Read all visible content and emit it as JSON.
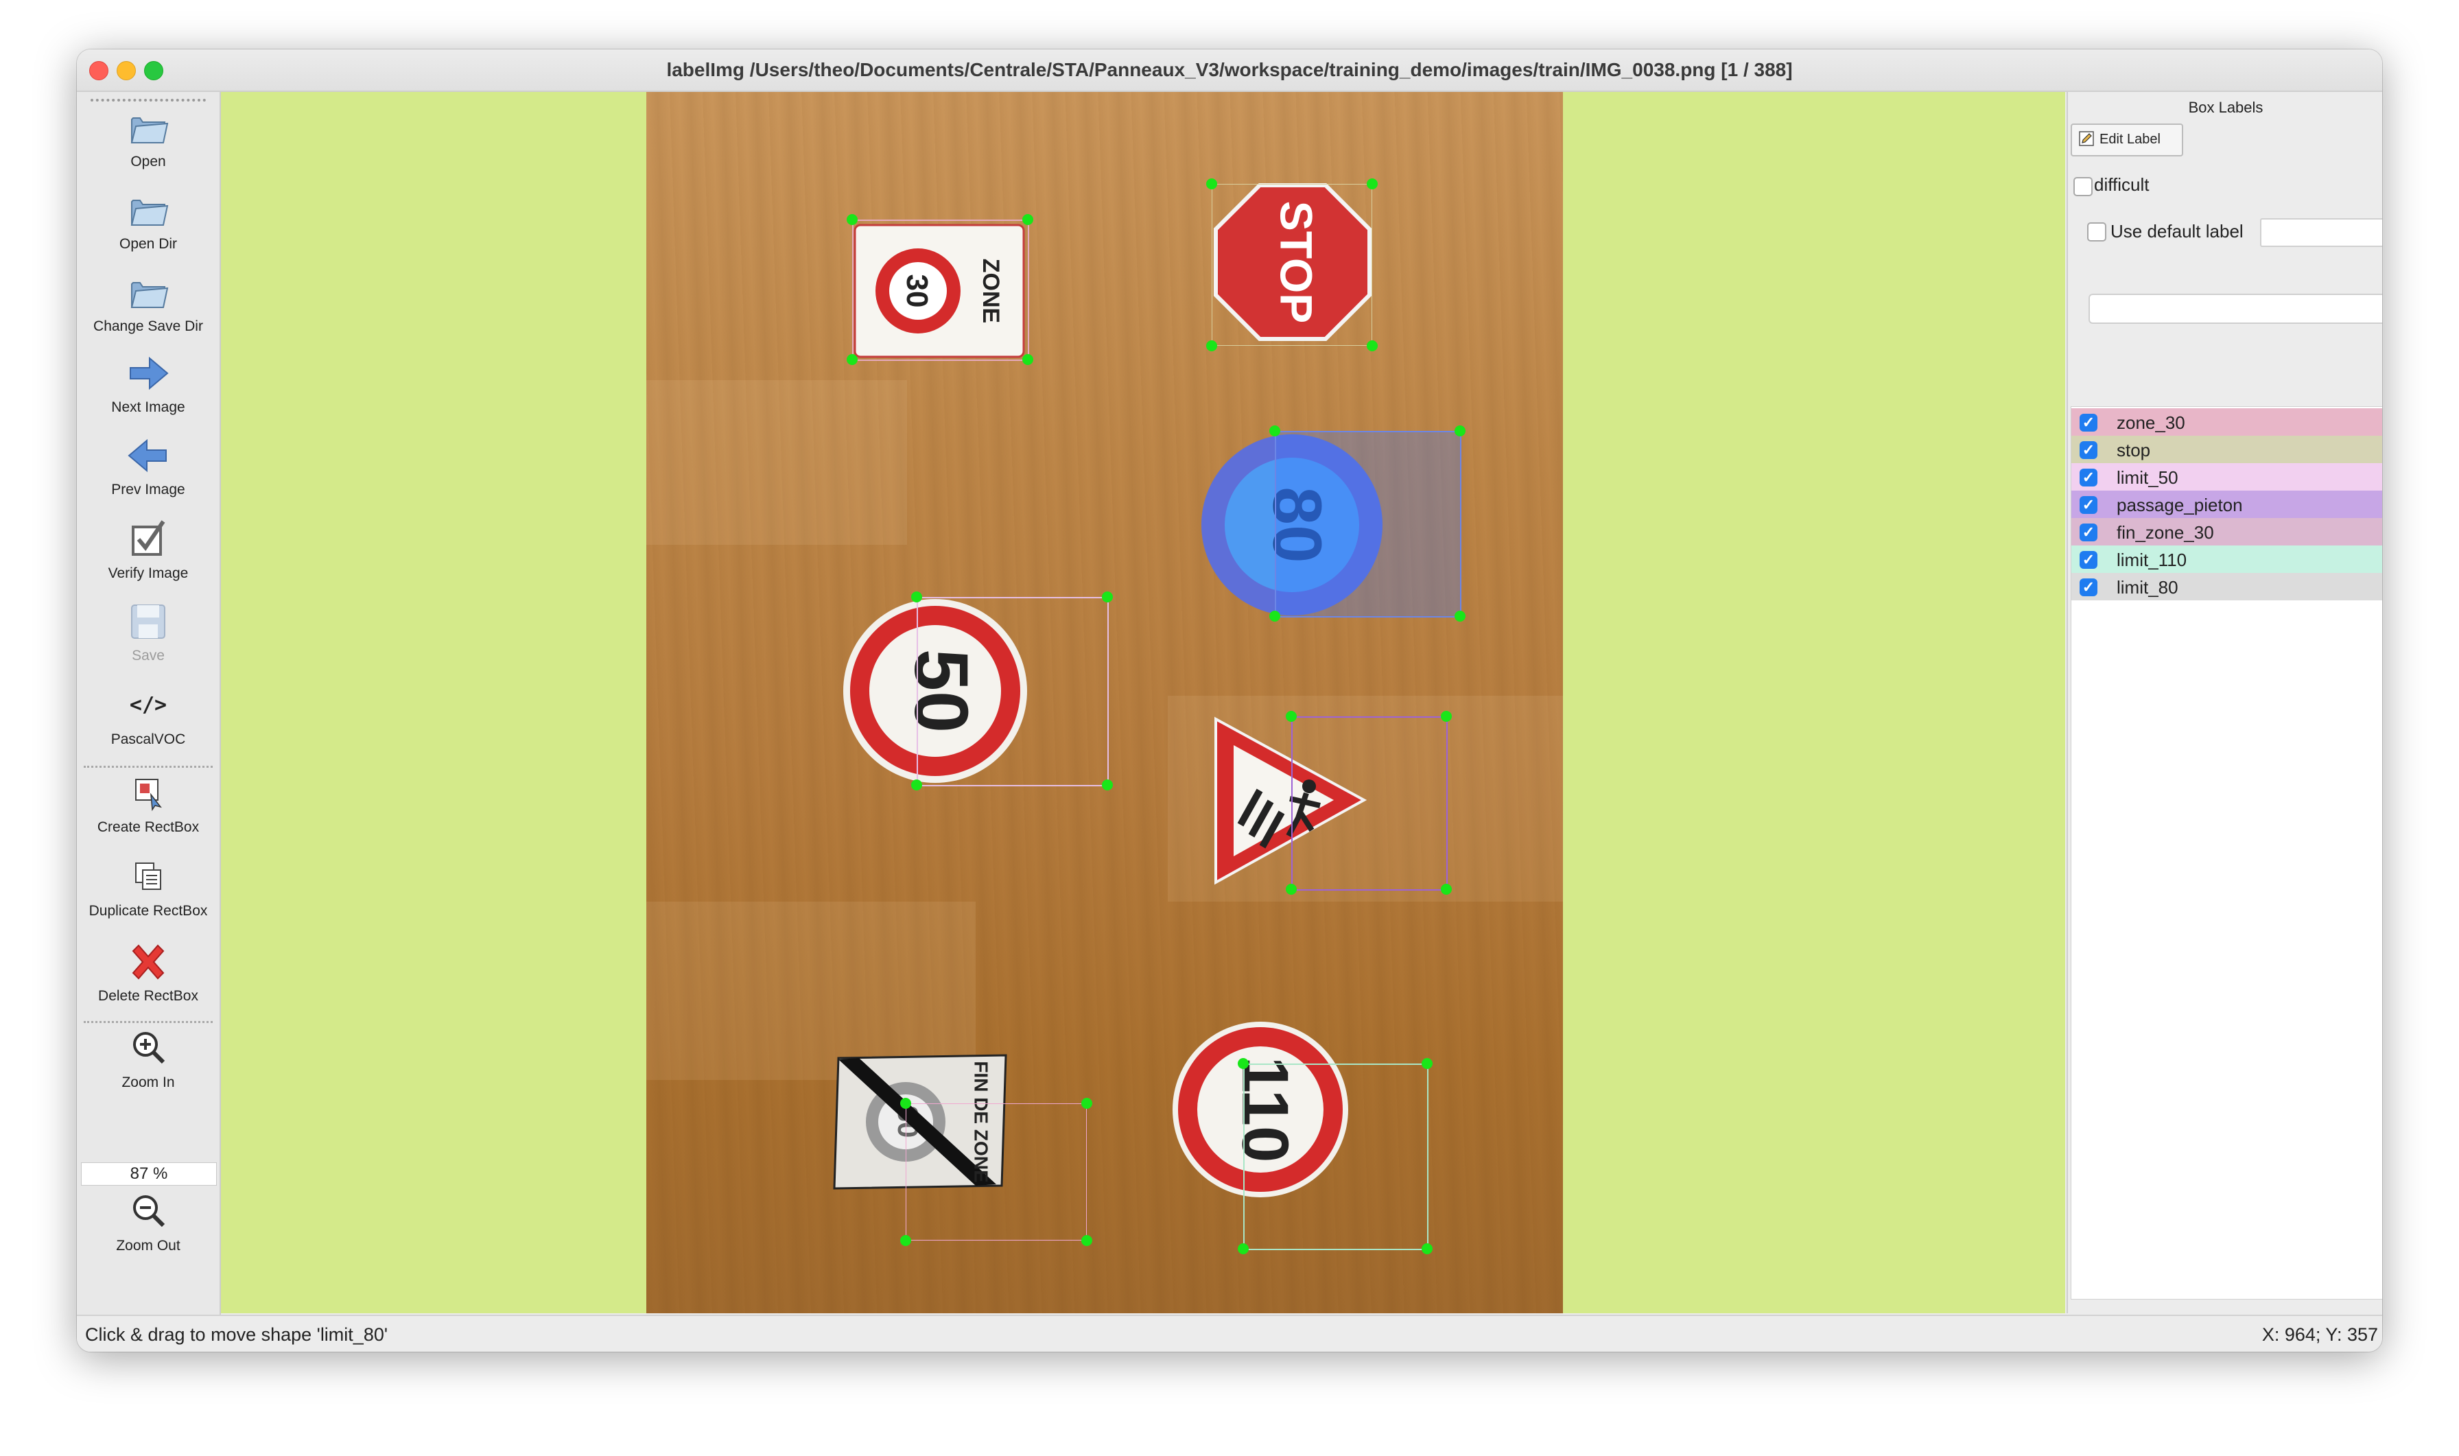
{
  "window": {
    "title": "labelImg /Users/theo/Documents/Centrale/STA/Panneaux_V3/workspace/training_demo/images/train/IMG_0038.png [1 / 388]"
  },
  "toolbar": {
    "open": "Open",
    "open_dir": "Open Dir",
    "change_save_dir": "Change Save Dir",
    "next_image": "Next Image",
    "prev_image": "Prev Image",
    "verify_image": "Verify Image",
    "save": "Save",
    "format": "PascalVOC",
    "format_icon_text": "</>",
    "create_rectbox": "Create RectBox",
    "duplicate_rectbox": "Duplicate RectBox",
    "delete_rectbox": "Delete RectBox",
    "zoom_in": "Zoom In",
    "zoom_level": "87 %",
    "zoom_out": "Zoom Out"
  },
  "signs": {
    "stop_text": "STOP",
    "zone_text": "ZONE",
    "zone_number": "30",
    "limit_80": "80",
    "limit_50": "50",
    "limit_110": "110",
    "fin_number": "30",
    "fin_text": "FIN DE ZONE"
  },
  "dock": {
    "title": "Box Labels",
    "edit_label": "Edit Label",
    "difficult": "difficult",
    "use_default_label": "Use default label",
    "default_label_value": "",
    "combo_value": ""
  },
  "labels": [
    {
      "name": "zone_30",
      "color": "#e8b6c8",
      "checked": true
    },
    {
      "name": "stop",
      "color": "#d6d4b4",
      "checked": true
    },
    {
      "name": "limit_50",
      "color": "#f2d0f0",
      "checked": true
    },
    {
      "name": "passage_pieton",
      "color": "#c7a6e6",
      "checked": true
    },
    {
      "name": "fin_zone_30",
      "color": "#dcb8d0",
      "checked": true
    },
    {
      "name": "limit_110",
      "color": "#c6f2e2",
      "checked": true
    },
    {
      "name": "limit_80",
      "color": "#dcdcdc",
      "checked": true
    }
  ],
  "status": {
    "message": "Click & drag to move shape 'limit_80'",
    "coords": "X: 964; Y: 357"
  }
}
